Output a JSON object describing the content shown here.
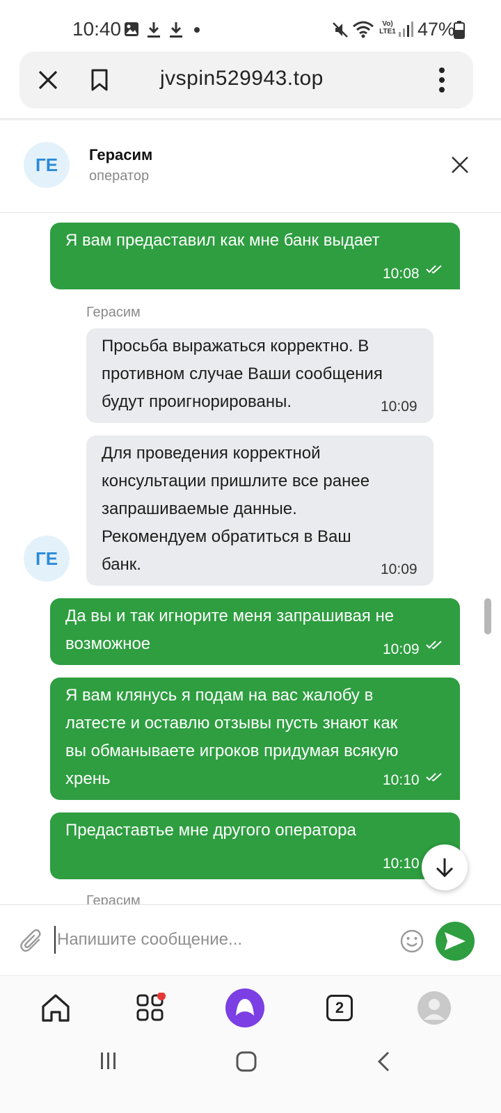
{
  "status_bar": {
    "time": "10:40",
    "battery_percent": "47%",
    "network_label": "Vo) LTE1",
    "icons": [
      "image-icon",
      "download-icon",
      "download-icon",
      "dot-icon",
      "mute-icon",
      "wifi-icon",
      "signal-icon",
      "battery-icon"
    ]
  },
  "browser": {
    "url": "jvspin529943.top",
    "icons": [
      "close-icon",
      "bookmark-icon",
      "more-vert-icon"
    ]
  },
  "chat": {
    "operator_initials": "ГЕ",
    "operator_name": "Герасим",
    "operator_role": "оператор",
    "messages": [
      {
        "direction": "out",
        "lines": [
          "Я вам предаставил как мне банк выдает"
        ],
        "time": "10:08",
        "read": true
      },
      {
        "direction": "in",
        "sender": "Герасим",
        "lines": [
          "Просьба выражаться корректно. В",
          "противном случае Ваши сообщения",
          "будут проигнорированы."
        ],
        "time": "10:09"
      },
      {
        "direction": "in",
        "lines": [
          "Для проведения корректной",
          "консультации пришлите все ранее",
          "запрашиваемые данные.",
          "Рекомендуем обратиться в Ваш",
          "банк."
        ],
        "time": "10:09"
      },
      {
        "direction": "out",
        "lines": [
          "Да вы и так игнорите меня запрашивая не",
          "возможное"
        ],
        "time": "10:09",
        "read": true
      },
      {
        "direction": "out",
        "lines": [
          "Я вам клянусь я подам на вас жалобу в",
          "латесте и оставлю отзывы пусть знают как",
          "вы обманываете игроков придумая всякую",
          "хрень"
        ],
        "time": "10:10",
        "read": true
      },
      {
        "direction": "out",
        "lines": [
          "Предаставтье мне другого оператора"
        ],
        "time": "10:10",
        "read": true
      }
    ],
    "next_sender_partial": "Герасим"
  },
  "composer": {
    "placeholder": "Напишите сообщение..."
  },
  "bottom_nav": {
    "tabs_count": "2",
    "items": [
      "home-icon",
      "services-icon",
      "alice-icon",
      "tabs-icon",
      "profile-icon"
    ],
    "badge_color": "#e53935"
  },
  "colors": {
    "outgoing_bubble": "#2e9e40",
    "incoming_bubble": "#e9ebee",
    "avatar_bg": "#e3f1fb",
    "avatar_text": "#2a8bd8",
    "alice": "#7b3fe4"
  }
}
